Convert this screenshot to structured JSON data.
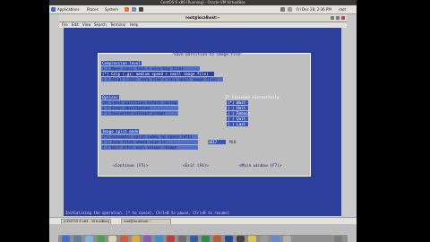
{
  "vm_window": {
    "title": "CentOS 6 x86 [Running] - Oracle VM VirtualBox"
  },
  "gnome_panel": {
    "menus": [
      "Applications",
      "Places",
      "System"
    ],
    "clock": "Fri Dec 28,  2:36 PM",
    "user": "root"
  },
  "terminal": {
    "title": "root@localhost:~",
    "menu": [
      "File",
      "Edit",
      "View",
      "Search",
      "Terminal",
      "Help"
    ]
  },
  "dialog": {
    "title": "Save partition to image file",
    "compression": {
      "label": "Compression level",
      "options": [
        "( ) None (very fast + very big file)",
        "(*) Gzip (.gz: medium speed + small image file)",
        "( ) Bzip2 (.bz2: very slow + very small image file)"
      ]
    },
    "options": {
      "label": "Options",
      "items": [
        "[X] Check partition before saving",
        "[ ] Enter description",
        "[ ] Overwrite without prompt"
      ]
    },
    "if_finished": {
      "label": "If finished successfully:",
      "items": [
        "(*) Wait",
        "( ) Halt",
        "( ) Reboot",
        "( ) Quit",
        "( ) Last"
      ]
    },
    "split": {
      "label": "Image split mode",
      "items": [
        "(*) Automatic split (when no space left)",
        "( ) Into files whose size is:............",
        "[ ] Wait after each volume change"
      ],
      "size_value": "2037",
      "size_unit": "MiB"
    },
    "buttons": {
      "continue": "<Continue (F5)>",
      "exit": "<Exit (F6)>",
      "main": "<Main window (F7)>"
    }
  },
  "status_line": "Initializing the operation. [* to cancel, Ctrl+B to pause, Ctrl+B to resume]",
  "taskbar": {
    "items": [
      "[CENTOS 6 x64 - VirtualBox]",
      "root@localhost:~"
    ]
  }
}
